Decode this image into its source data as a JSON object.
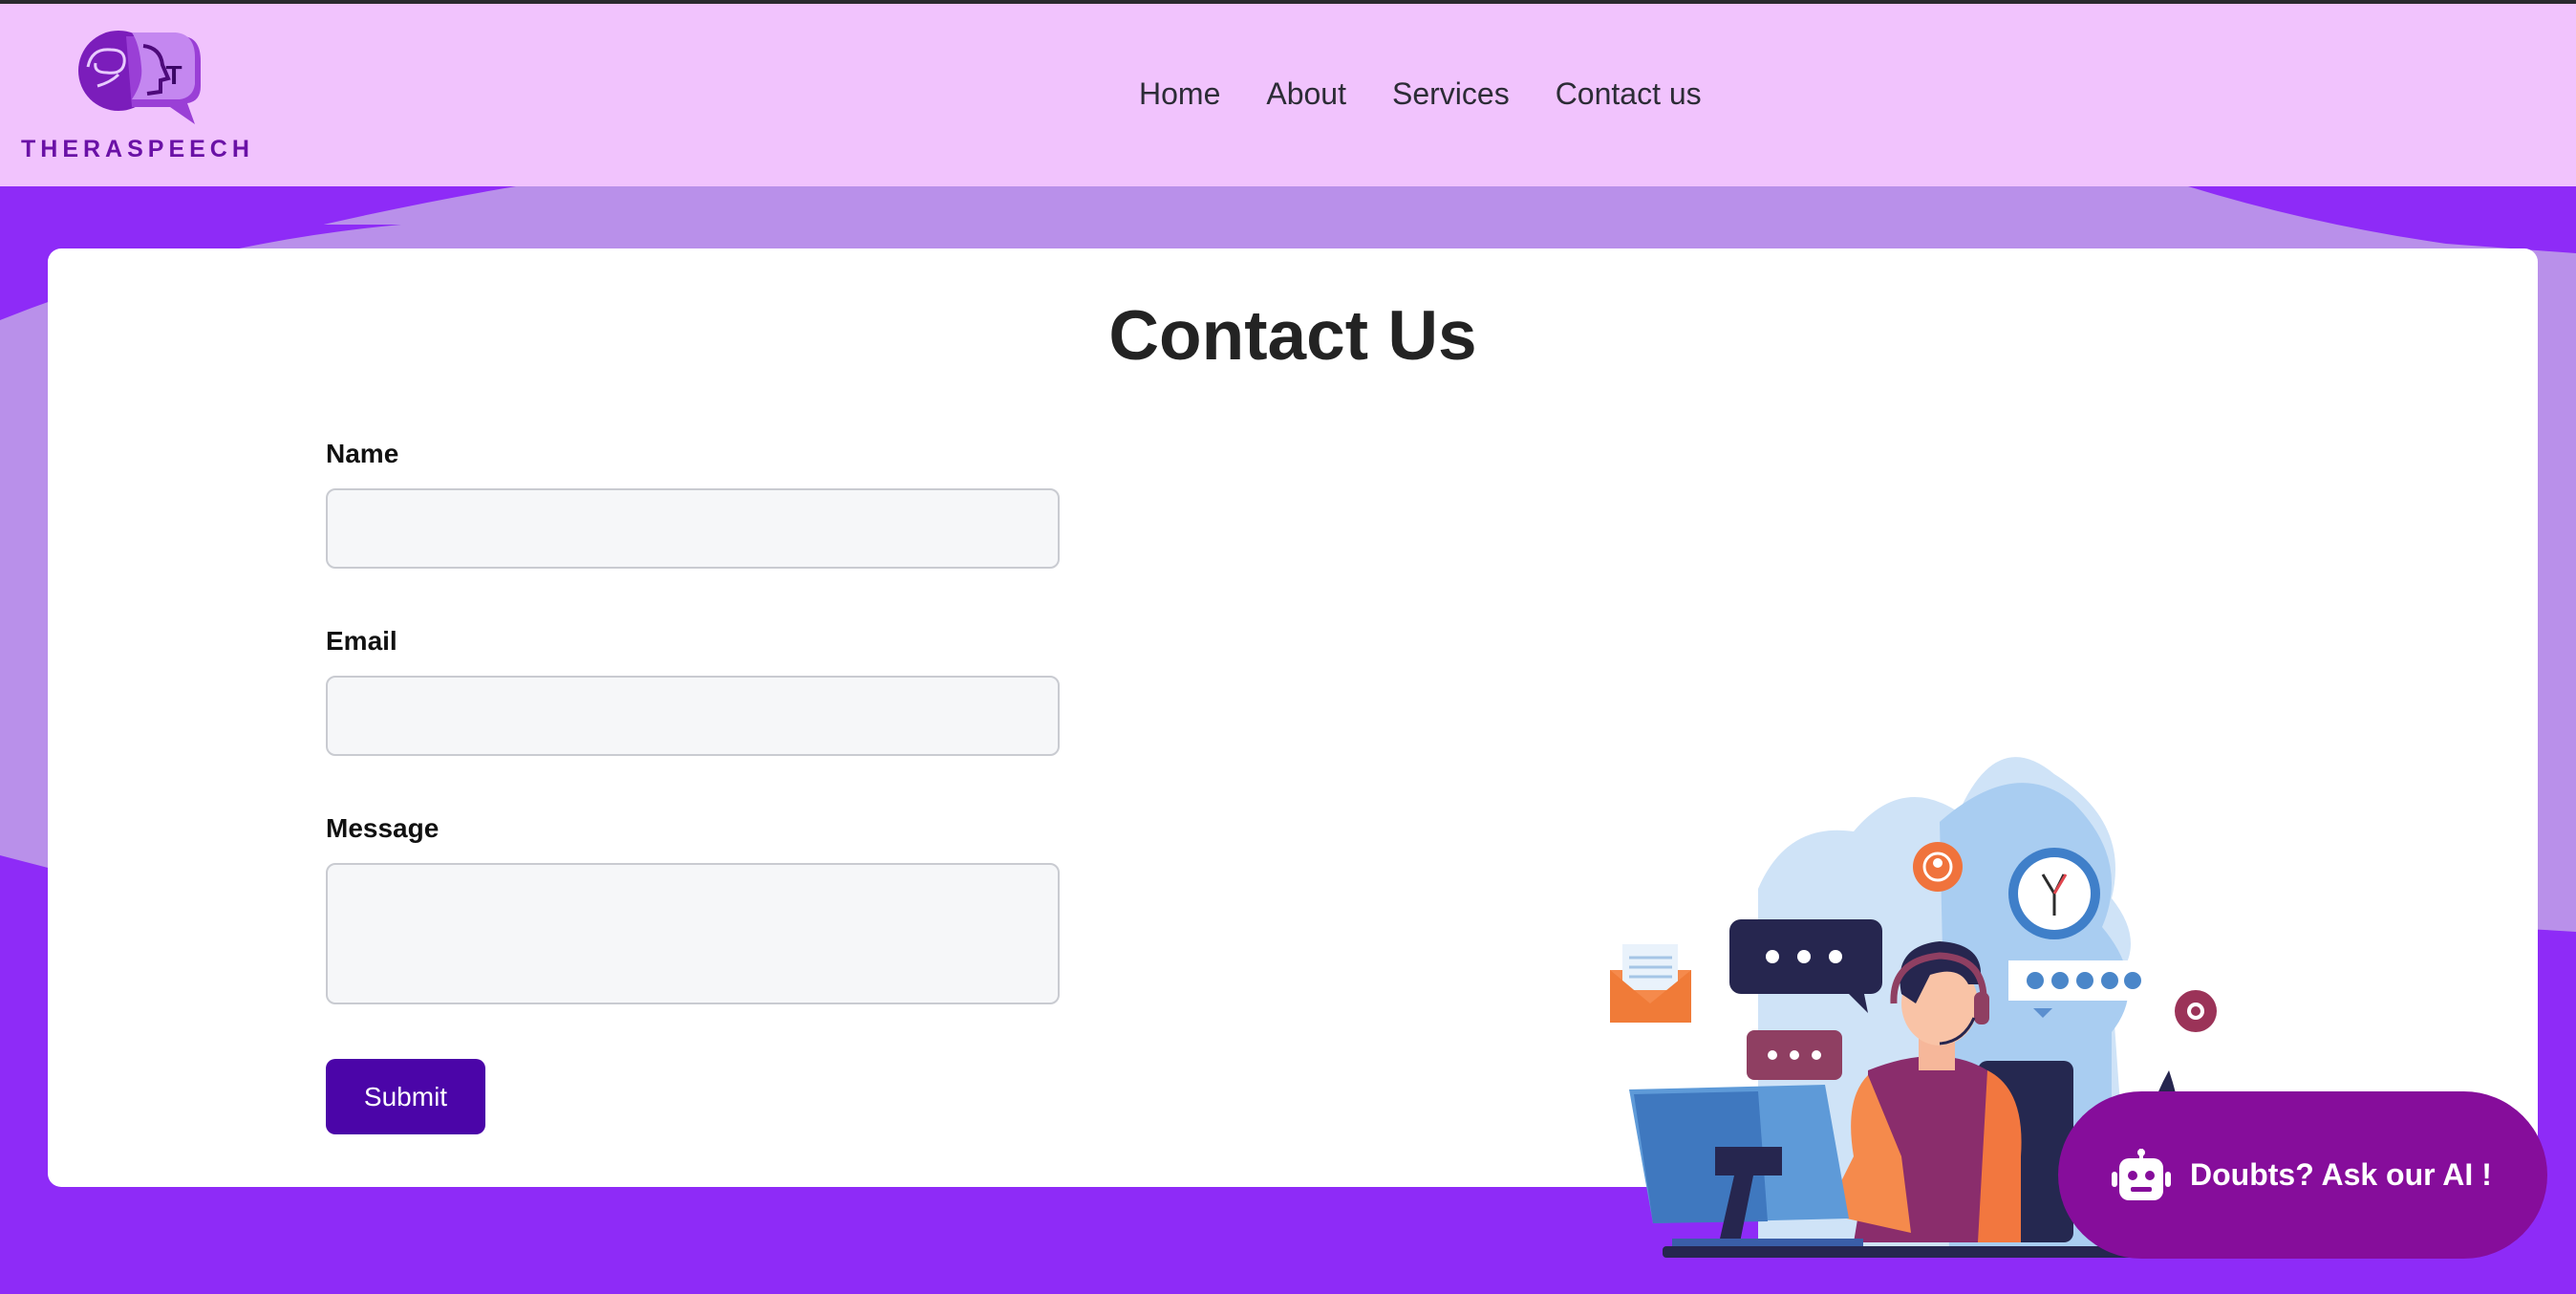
{
  "brand": {
    "name": "THERASPEECH",
    "logo_letter": "T",
    "accent": "#6a11a6"
  },
  "nav": {
    "items": [
      "Home",
      "About",
      "Services",
      "Contact us"
    ]
  },
  "page": {
    "title": "Contact Us"
  },
  "form": {
    "name_label": "Name",
    "name_value": "",
    "email_label": "Email",
    "email_value": "",
    "message_label": "Message",
    "message_value": "",
    "submit_label": "Submit"
  },
  "chat_widget": {
    "label": "Doubts? Ask our AI !",
    "icon": "robot-icon"
  },
  "colors": {
    "header_bg": "#f1c3fd",
    "page_bg": "#8e2bf7",
    "button": "#4b05a8",
    "chat_button": "#860d9b"
  }
}
